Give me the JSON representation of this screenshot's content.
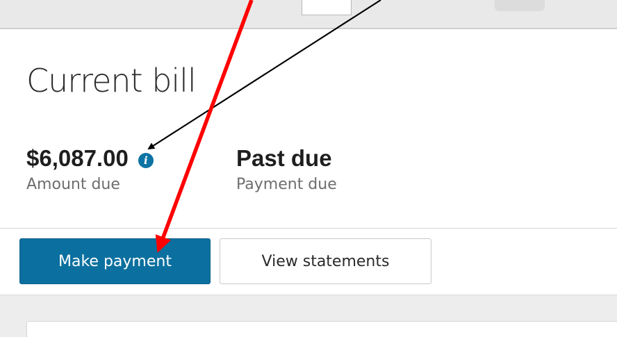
{
  "page": {
    "title": "Current bill"
  },
  "summary": {
    "amount": {
      "value": "$6,087.00",
      "label": "Amount due",
      "icon": "info-icon"
    },
    "due": {
      "value": "Past due",
      "label": "Payment due"
    }
  },
  "actions": {
    "make_payment": "Make payment",
    "view_statements": "View statements"
  },
  "colors": {
    "primary_button": "#0b709f",
    "info_icon": "#0d73a4",
    "annotation_red": "#ff0000",
    "annotation_black": "#000000"
  }
}
